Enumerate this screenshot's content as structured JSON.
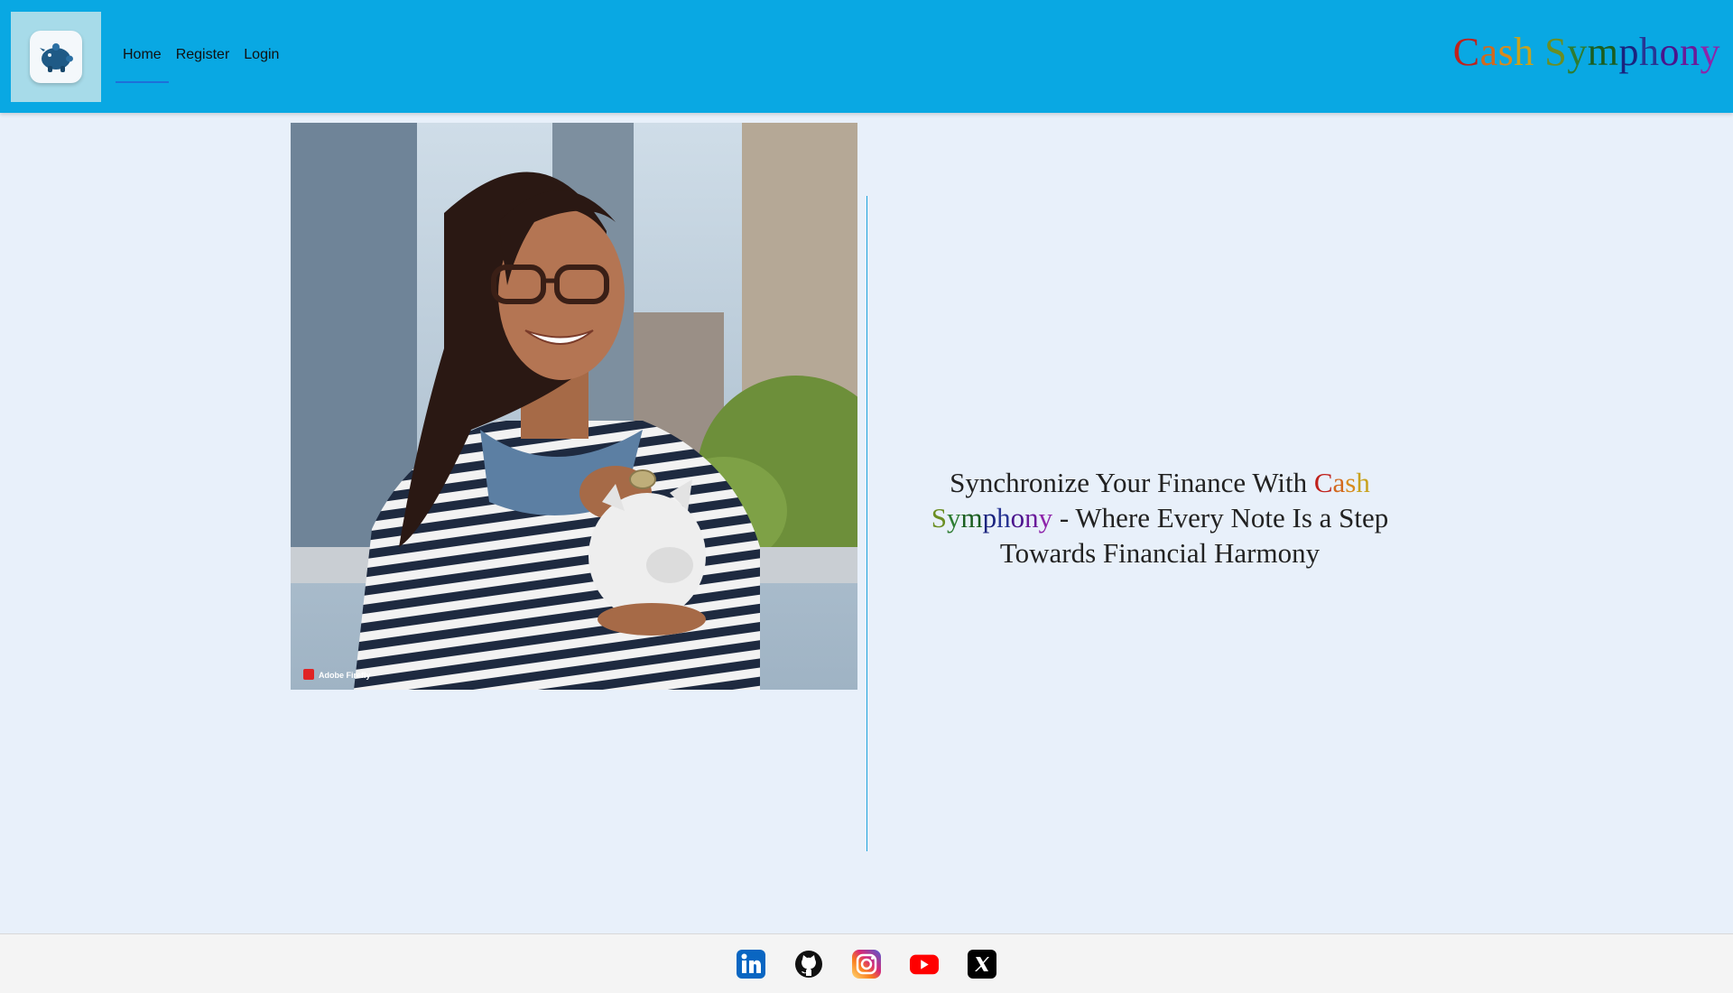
{
  "nav": {
    "items": [
      {
        "label": "Home"
      },
      {
        "label": "Register"
      },
      {
        "label": "Login"
      }
    ]
  },
  "brand": {
    "letters": [
      {
        "ch": "C",
        "color": "#c0211b"
      },
      {
        "ch": "a",
        "color": "#d2691e"
      },
      {
        "ch": "s",
        "color": "#d88a1d"
      },
      {
        "ch": "h",
        "color": "#c8a21e"
      },
      {
        "ch": " ",
        "color": "#000000"
      },
      {
        "ch": "S",
        "color": "#6b8e23"
      },
      {
        "ch": "y",
        "color": "#2e7d32"
      },
      {
        "ch": "m",
        "color": "#1b5e20"
      },
      {
        "ch": "p",
        "color": "#1a237e"
      },
      {
        "ch": "h",
        "color": "#283593"
      },
      {
        "ch": "o",
        "color": "#4a148c"
      },
      {
        "ch": "n",
        "color": "#6a1b9a"
      },
      {
        "ch": "y",
        "color": "#8e24aa"
      }
    ]
  },
  "hero": {
    "image_label": "Adobe Firefly"
  },
  "tagline": {
    "prefix": "Synchronize Your Finance With ",
    "suffix": " - Where Every Note Is a Step Towards Financial Harmony"
  },
  "footer": {
    "icons": [
      "linkedin-icon",
      "github-icon",
      "instagram-icon",
      "youtube-icon",
      "x-icon"
    ]
  },
  "colors": {
    "navbar": "#09a8e3",
    "page_bg": "#e8f0fa",
    "divider": "#1ba2dc"
  }
}
